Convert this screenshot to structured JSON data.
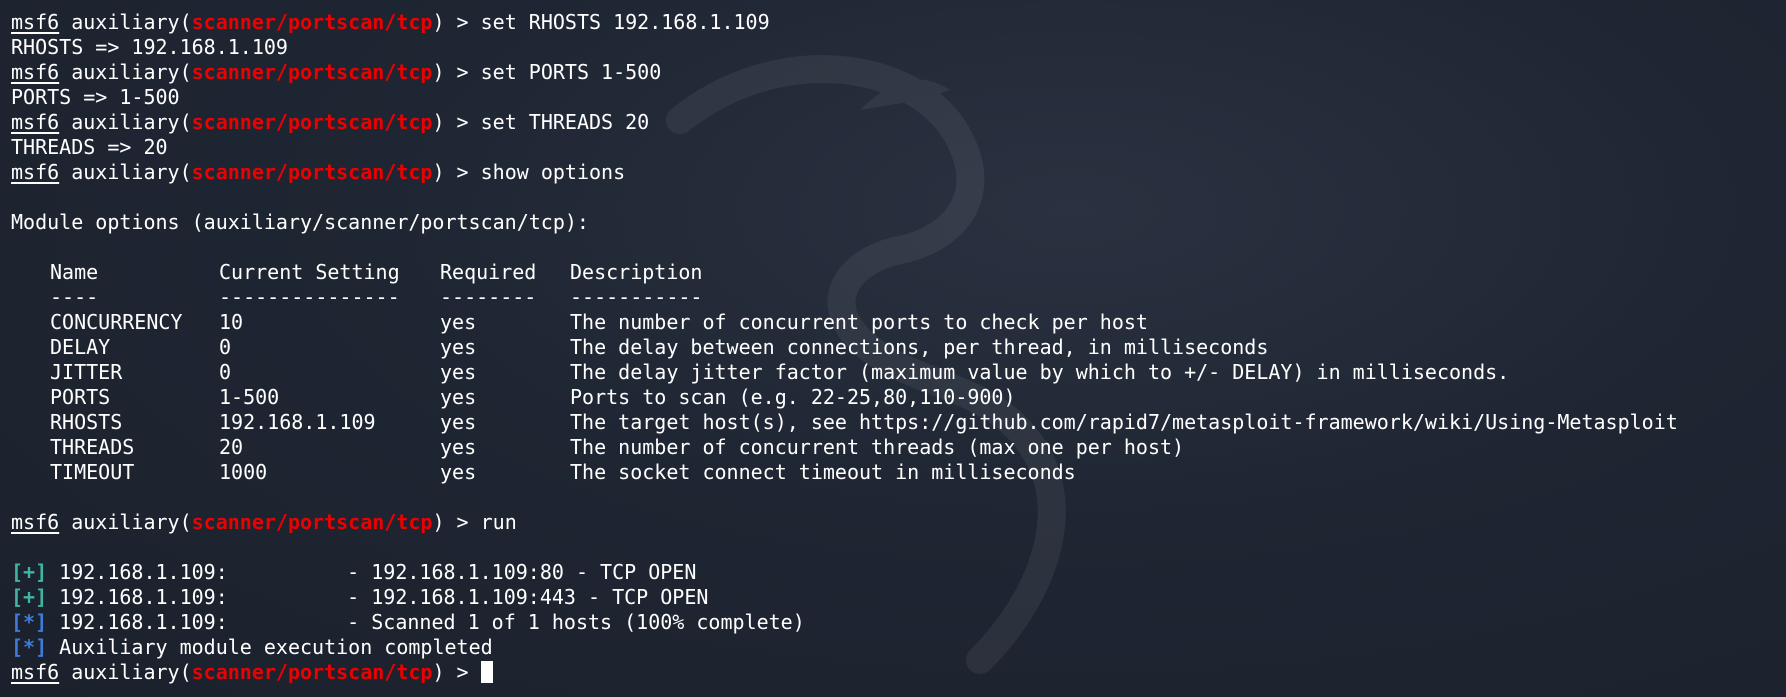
{
  "prompt": {
    "app": "msf6",
    "module_type": "auxiliary(",
    "module_path": "scanner/portscan/tcp",
    "suffix": ") > "
  },
  "commands": [
    "set RHOSTS 192.168.1.109",
    "set PORTS 1-500",
    "set THREADS 20",
    "show options",
    "run"
  ],
  "outputs": [
    "RHOSTS => 192.168.1.109",
    "PORTS => 1-500",
    "THREADS => 20"
  ],
  "options": {
    "title": "Module options (auxiliary/scanner/portscan/tcp):",
    "headers": [
      "Name",
      "Current Setting",
      "Required",
      "Description"
    ],
    "underlines": [
      "----",
      "---------------",
      "--------",
      "-----------"
    ],
    "rows": [
      {
        "name": "CONCURRENCY",
        "setting": "10",
        "required": "yes",
        "description": "The number of concurrent ports to check per host"
      },
      {
        "name": "DELAY",
        "setting": "0",
        "required": "yes",
        "description": "The delay between connections, per thread, in milliseconds"
      },
      {
        "name": "JITTER",
        "setting": "0",
        "required": "yes",
        "description": "The delay jitter factor (maximum value by which to +/- DELAY) in milliseconds."
      },
      {
        "name": "PORTS",
        "setting": "1-500",
        "required": "yes",
        "description": "Ports to scan (e.g. 22-25,80,110-900)"
      },
      {
        "name": "RHOSTS",
        "setting": "192.168.1.109",
        "required": "yes",
        "description": "The target host(s), see https://github.com/rapid7/metasploit-framework/wiki/Using-Metasploit"
      },
      {
        "name": "THREADS",
        "setting": "20",
        "required": "yes",
        "description": "The number of concurrent threads (max one per host)"
      },
      {
        "name": "TIMEOUT",
        "setting": "1000",
        "required": "yes",
        "description": "The socket connect timeout in milliseconds"
      }
    ]
  },
  "results": [
    {
      "marker": "[+]",
      "kind": "good",
      "host": "192.168.1.109:",
      "message": "- 192.168.1.109:80 - TCP OPEN"
    },
    {
      "marker": "[+]",
      "kind": "good",
      "host": "192.168.1.109:",
      "message": "- 192.168.1.109:443 - TCP OPEN"
    },
    {
      "marker": "[*]",
      "kind": "status",
      "host": "192.168.1.109:",
      "message": "- Scanned 1 of 1 hosts (100% complete)"
    },
    {
      "marker": "[*]",
      "kind": "status",
      "host": "",
      "message": "Auxiliary module execution completed"
    }
  ],
  "colors": {
    "background": "#1f2633",
    "text": "#ffffff",
    "module_path": "#ec0101",
    "good_marker": "#3fb5a3",
    "status_marker": "#3f7bd9"
  },
  "icons": [
    "kali-dragon-watermark-icon"
  ]
}
